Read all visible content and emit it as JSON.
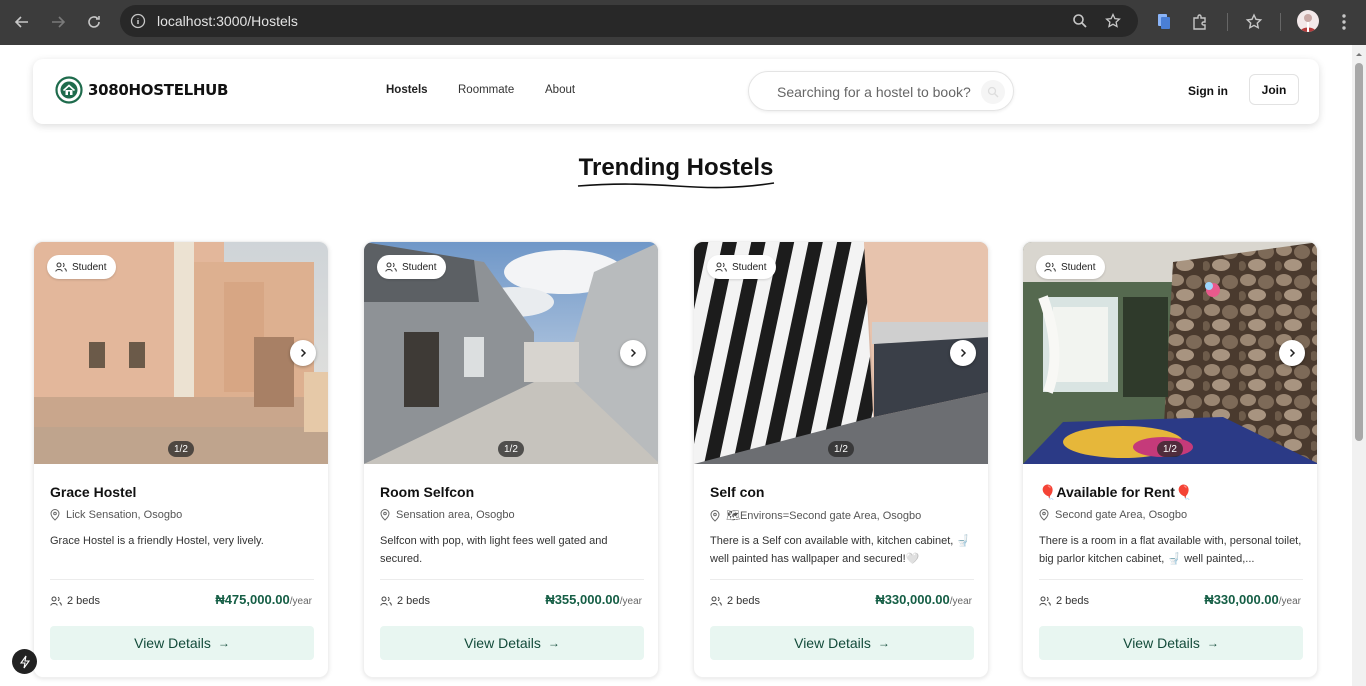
{
  "browser": {
    "url": "localhost:3000/Hostels"
  },
  "navbar": {
    "brand": "3080HOSTELHUB",
    "links": [
      "Hostels",
      "Roommate",
      "About"
    ],
    "search_placeholder": "Searching for a hostel to book?",
    "signin_label": "Sign in",
    "join_label": "Join"
  },
  "section": {
    "title": "Trending Hostels"
  },
  "cards": [
    {
      "badge": "Student",
      "counter": "1/2",
      "title": "Grace Hostel",
      "location": "Lick Sensation, Osogbo",
      "description": "Grace Hostel is a friendly Hostel, very lively.",
      "beds": "2 beds",
      "price": "₦475,000.00",
      "period": "/year",
      "cta": "View Details"
    },
    {
      "badge": "Student",
      "counter": "1/2",
      "title": "Room Selfcon",
      "location": "Sensation area, Osogbo",
      "description": "Selfcon with pop, with light fees well gated and secured.",
      "beds": "2 beds",
      "price": "₦355,000.00",
      "period": "/year",
      "cta": "View Details"
    },
    {
      "badge": "Student",
      "counter": "1/2",
      "title": "Self con",
      "location": "🗺Environs=Second gate Area, Osogbo",
      "description": "There is a Self con available with, kitchen cabinet, 🚽 well painted has wallpaper and secured!🤍",
      "beds": "2 beds",
      "price": "₦330,000.00",
      "period": "/year",
      "cta": "View Details"
    },
    {
      "badge": "Student",
      "counter": "1/2",
      "title": "🎈Available for Rent🎈",
      "location": "Second gate Area, Osogbo",
      "description": "There is a room in a flat available with, personal toilet, big parlor kitchen cabinet, 🚽 well painted,...",
      "beds": "2 beds",
      "price": "₦330,000.00",
      "period": "/year",
      "cta": "View Details"
    }
  ],
  "colors": {
    "accent": "#155e45",
    "button_bg": "#e8f6f1",
    "chrome_bg": "#3c3c3c"
  }
}
